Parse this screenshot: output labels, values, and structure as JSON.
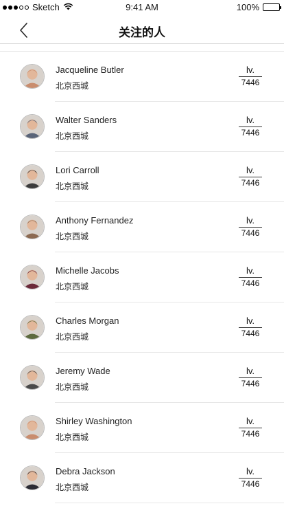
{
  "status_bar": {
    "carrier": "Sketch",
    "time": "9:41 AM",
    "battery": "100%",
    "signal_icon": "signal-dots-icon",
    "wifi_icon": "wifi-icon",
    "battery_icon": "battery-icon",
    "battery_level": 1.0
  },
  "nav": {
    "title": "关注的人",
    "back_icon": "chevron-left-icon"
  },
  "follows": [
    {
      "name": "Jacqueline Butler",
      "city": "北京西城",
      "level_label": "lv.",
      "level_num": "7446",
      "avatar_color": "#c98d6e"
    },
    {
      "name": "Walter Sanders",
      "city": "北京西城",
      "level_label": "lv.",
      "level_num": "7446",
      "avatar_color": "#5a6478"
    },
    {
      "name": "Lori Carroll",
      "city": "北京西城",
      "level_label": "lv.",
      "level_num": "7446",
      "avatar_color": "#3c3c3c"
    },
    {
      "name": "Anthony Fernandez",
      "city": "北京西城",
      "level_label": "lv.",
      "level_num": "7446",
      "avatar_color": "#8c6a52"
    },
    {
      "name": "Michelle Jacobs",
      "city": "北京西城",
      "level_label": "lv.",
      "level_num": "7446",
      "avatar_color": "#6b2a3a"
    },
    {
      "name": "Charles Morgan",
      "city": "北京西城",
      "level_label": "lv.",
      "level_num": "7446",
      "avatar_color": "#5d6a3e"
    },
    {
      "name": "Jeremy Wade",
      "city": "北京西城",
      "level_label": "lv.",
      "level_num": "7446",
      "avatar_color": "#4a4a4a"
    },
    {
      "name": "Shirley Washington",
      "city": "北京西城",
      "level_label": "lv.",
      "level_num": "7446",
      "avatar_color": "#c98d6e"
    },
    {
      "name": "Debra Jackson",
      "city": "北京西城",
      "level_label": "lv.",
      "level_num": "7446",
      "avatar_color": "#2b2b33"
    }
  ]
}
